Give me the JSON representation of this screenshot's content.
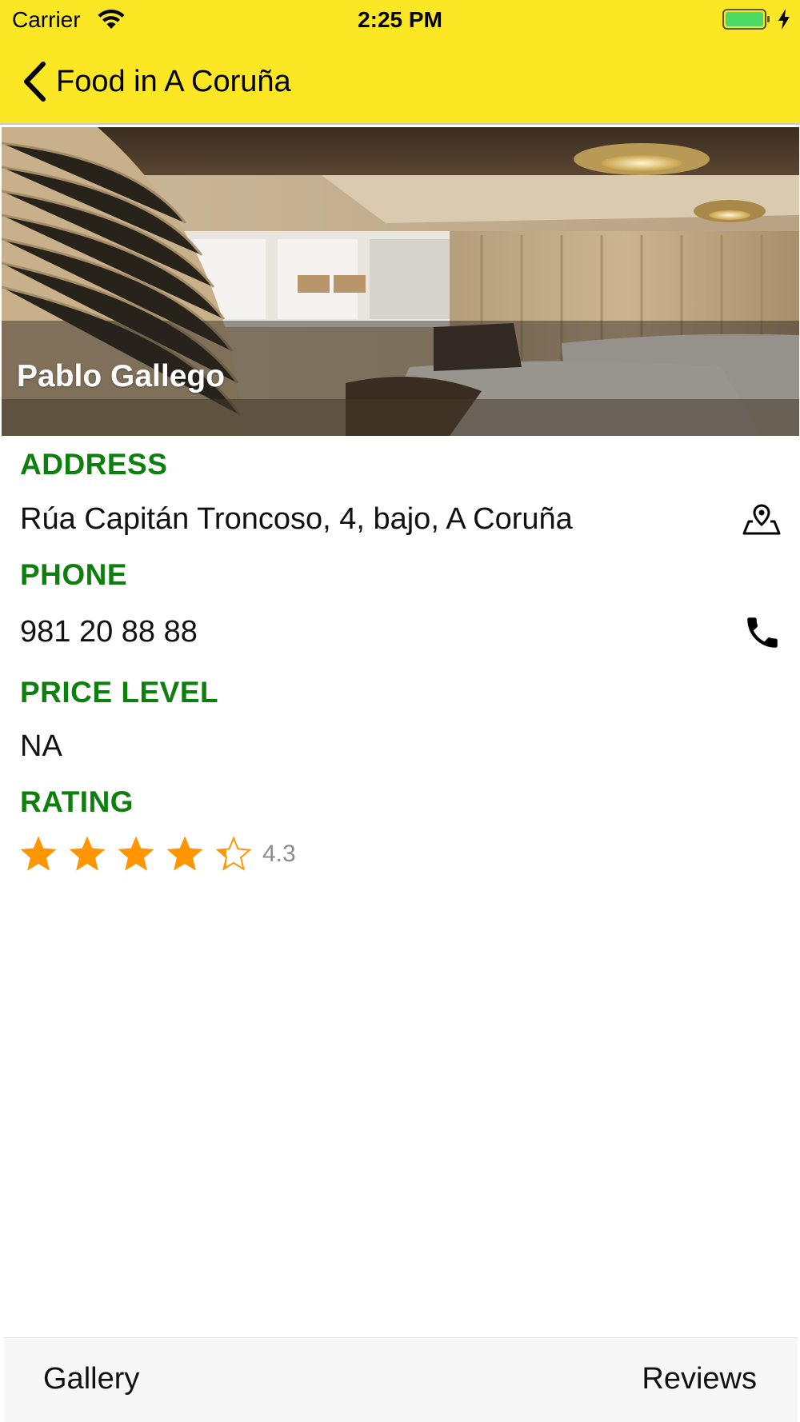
{
  "status_bar": {
    "carrier": "Carrier",
    "time": "2:25 PM",
    "battery_color": "#4cd964"
  },
  "nav": {
    "back_label": "Food in A Coruña",
    "background": "#fce724"
  },
  "hero": {
    "title": "Pablo Gallego"
  },
  "details": {
    "address_label": "ADDRESS",
    "address_value": "Rúa Capitán Troncoso, 4, bajo, A Coruña",
    "address_icon": "map-pin-icon",
    "phone_label": "PHONE",
    "phone_value": "981 20 88 88",
    "phone_icon": "phone-icon",
    "price_label": "PRICE LEVEL",
    "price_value": "NA",
    "rating_label": "RATING",
    "rating_value": "4.3",
    "rating_max": 5,
    "label_color": "#0d7f0d",
    "star_color": "#ff9500"
  },
  "tabbar": {
    "gallery_label": "Gallery",
    "reviews_label": "Reviews"
  }
}
